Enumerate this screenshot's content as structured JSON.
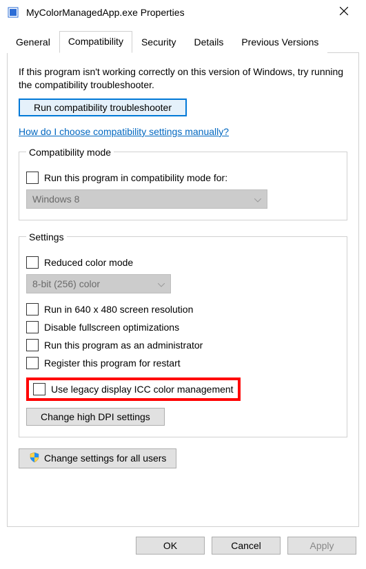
{
  "window": {
    "title": "MyColorManagedApp.exe Properties"
  },
  "tabs": {
    "general": "General",
    "compatibility": "Compatibility",
    "security": "Security",
    "details": "Details",
    "previous_versions": "Previous Versions"
  },
  "intro": "If this program isn't working correctly on this version of Windows, try running the compatibility troubleshooter.",
  "buttons": {
    "run_troubleshooter": "Run compatibility troubleshooter",
    "change_dpi": "Change high DPI settings",
    "change_all_users": "Change settings for all users",
    "ok": "OK",
    "cancel": "Cancel",
    "apply": "Apply"
  },
  "link": "How do I choose compatibility settings manually?",
  "compat_mode": {
    "legend": "Compatibility mode",
    "checkbox": "Run this program in compatibility mode for:",
    "selected": "Windows 8"
  },
  "settings": {
    "legend": "Settings",
    "reduced_color": "Reduced color mode",
    "color_selected": "8-bit (256) color",
    "run_640": "Run in 640 x 480 screen resolution",
    "disable_fullscreen": "Disable fullscreen optimizations",
    "run_admin": "Run this program as an administrator",
    "register_restart": "Register this program for restart",
    "legacy_icc": "Use legacy display ICC color management"
  }
}
